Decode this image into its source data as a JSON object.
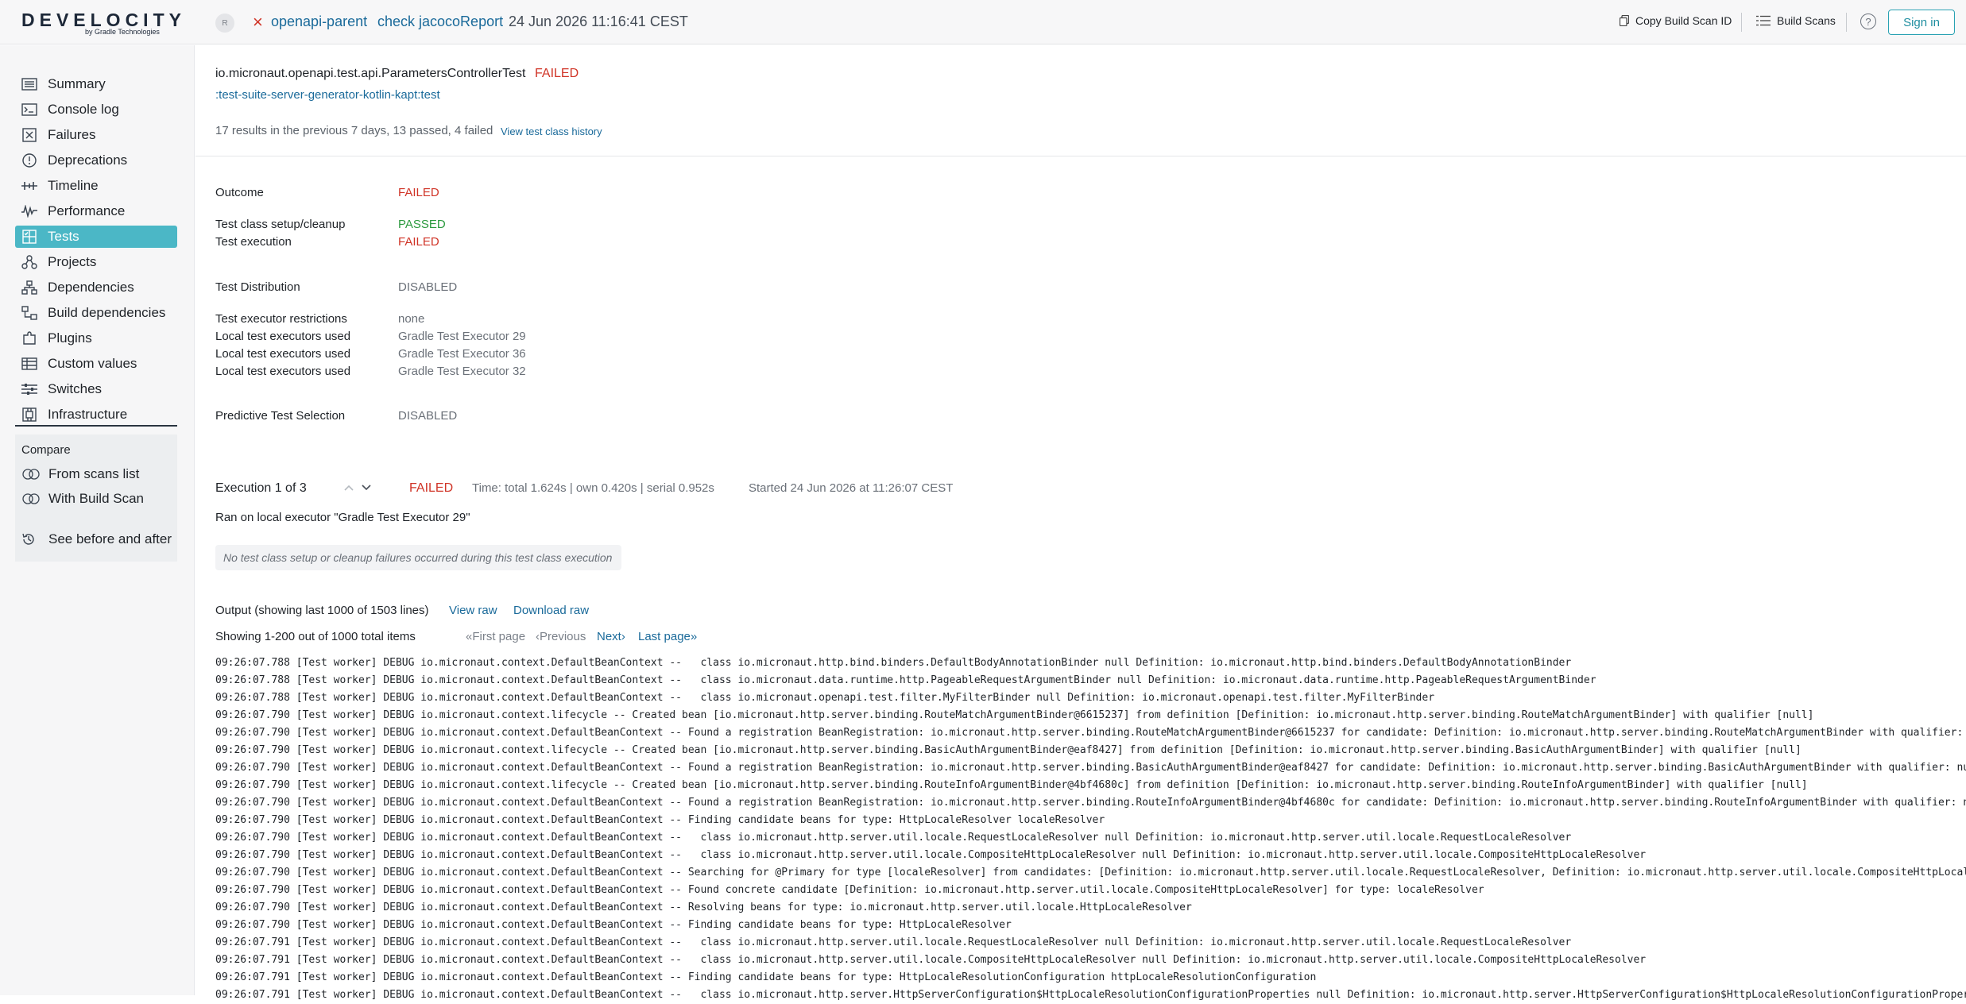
{
  "header": {
    "logo": "DEVELOCITY",
    "logo_sub": "by Gradle Technologies",
    "avatar": "R",
    "project": "openapi-parent",
    "task": "check jacocoReport",
    "datetime": "24 Jun 2026 11:16:41 CEST",
    "copy_id": "Copy Build Scan ID",
    "build_scans": "Build Scans",
    "help": "?",
    "sign_in": "Sign in"
  },
  "sidebar": {
    "items": [
      {
        "label": "Summary",
        "icon": "summary-icon"
      },
      {
        "label": "Console log",
        "icon": "console-icon"
      },
      {
        "label": "Failures",
        "icon": "failures-icon"
      },
      {
        "label": "Deprecations",
        "icon": "deprecations-icon"
      },
      {
        "label": "Timeline",
        "icon": "timeline-icon"
      },
      {
        "label": "Performance",
        "icon": "performance-icon"
      },
      {
        "label": "Tests",
        "icon": "tests-icon"
      },
      {
        "label": "Projects",
        "icon": "projects-icon"
      },
      {
        "label": "Dependencies",
        "icon": "dependencies-icon"
      },
      {
        "label": "Build dependencies",
        "icon": "build-dependencies-icon"
      },
      {
        "label": "Plugins",
        "icon": "plugins-icon"
      },
      {
        "label": "Custom values",
        "icon": "custom-values-icon"
      },
      {
        "label": "Switches",
        "icon": "switches-icon"
      },
      {
        "label": "Infrastructure",
        "icon": "infrastructure-icon"
      }
    ],
    "active": "Tests",
    "compare": {
      "title": "Compare",
      "from_list": "From scans list",
      "with_scan": "With Build Scan"
    },
    "before_after": "See before and after"
  },
  "test": {
    "class_name": "io.micronaut.openapi.test.api.ParametersControllerTest",
    "class_status": "FAILED",
    "task_path": ":test-suite-server-generator-kotlin-kapt:test",
    "history": "17 results in the previous 7 days, 13 passed, 4 failed",
    "history_link": "View test class history"
  },
  "details": {
    "outcome_label": "Outcome",
    "outcome": "FAILED",
    "setup_label": "Test class setup/cleanup",
    "setup": "PASSED",
    "execution_label": "Test execution",
    "execution": "FAILED",
    "distribution_label": "Test Distribution",
    "distribution": "DISABLED",
    "restrictions_label": "Test executor restrictions",
    "restrictions": "none",
    "executors_label": "Local test executors used",
    "executors": [
      "Gradle Test Executor 29",
      "Gradle Test Executor 36",
      "Gradle Test Executor 32"
    ],
    "pts_label": "Predictive Test Selection",
    "pts": "DISABLED"
  },
  "execution": {
    "title": "Execution 1 of 3",
    "status": "FAILED",
    "time": "Time: total 1.624s | own 0.420s | serial 0.952s",
    "started": "Started 24 Jun 2026 at 11:26:07 CEST",
    "ran_on": "Ran on local executor \"Gradle Test Executor 29\"",
    "note": "No test class setup or cleanup failures occurred during this test class execution"
  },
  "output": {
    "title": "Output (showing last 1000 of 1503 lines)",
    "view_raw": "View raw",
    "download_raw": "Download raw",
    "showing": "Showing 1-200 out of 1000 total items",
    "first_page": "«First page",
    "previous": "‹Previous",
    "next": "Next›",
    "last_page": "Last page»",
    "lines": [
      "09:26:07.788 [Test worker] DEBUG io.micronaut.context.DefaultBeanContext --   class io.micronaut.http.bind.binders.DefaultBodyAnnotationBinder null Definition: io.micronaut.http.bind.binders.DefaultBodyAnnotationBinder",
      "09:26:07.788 [Test worker] DEBUG io.micronaut.context.DefaultBeanContext --   class io.micronaut.data.runtime.http.PageableRequestArgumentBinder null Definition: io.micronaut.data.runtime.http.PageableRequestArgumentBinder",
      "09:26:07.788 [Test worker] DEBUG io.micronaut.context.DefaultBeanContext --   class io.micronaut.openapi.test.filter.MyFilterBinder null Definition: io.micronaut.openapi.test.filter.MyFilterBinder",
      "09:26:07.790 [Test worker] DEBUG io.micronaut.context.lifecycle -- Created bean [io.micronaut.http.server.binding.RouteMatchArgumentBinder@6615237] from definition [Definition: io.micronaut.http.server.binding.RouteMatchArgumentBinder] with qualifier [null]",
      "09:26:07.790 [Test worker] DEBUG io.micronaut.context.DefaultBeanContext -- Found a registration BeanRegistration: io.micronaut.http.server.binding.RouteMatchArgumentBinder@6615237 for candidate: Definition: io.micronaut.http.server.binding.RouteMatchArgumentBinder with qualifier: null",
      "09:26:07.790 [Test worker] DEBUG io.micronaut.context.lifecycle -- Created bean [io.micronaut.http.server.binding.BasicAuthArgumentBinder@eaf8427] from definition [Definition: io.micronaut.http.server.binding.BasicAuthArgumentBinder] with qualifier [null]",
      "09:26:07.790 [Test worker] DEBUG io.micronaut.context.DefaultBeanContext -- Found a registration BeanRegistration: io.micronaut.http.server.binding.BasicAuthArgumentBinder@eaf8427 for candidate: Definition: io.micronaut.http.server.binding.BasicAuthArgumentBinder with qualifier: null",
      "09:26:07.790 [Test worker] DEBUG io.micronaut.context.lifecycle -- Created bean [io.micronaut.http.server.binding.RouteInfoArgumentBinder@4bf4680c] from definition [Definition: io.micronaut.http.server.binding.RouteInfoArgumentBinder] with qualifier [null]",
      "09:26:07.790 [Test worker] DEBUG io.micronaut.context.DefaultBeanContext -- Found a registration BeanRegistration: io.micronaut.http.server.binding.RouteInfoArgumentBinder@4bf4680c for candidate: Definition: io.micronaut.http.server.binding.RouteInfoArgumentBinder with qualifier: null",
      "09:26:07.790 [Test worker] DEBUG io.micronaut.context.DefaultBeanContext -- Finding candidate beans for type: HttpLocaleResolver localeResolver",
      "09:26:07.790 [Test worker] DEBUG io.micronaut.context.DefaultBeanContext --   class io.micronaut.http.server.util.locale.RequestLocaleResolver null Definition: io.micronaut.http.server.util.locale.RequestLocaleResolver",
      "09:26:07.790 [Test worker] DEBUG io.micronaut.context.DefaultBeanContext --   class io.micronaut.http.server.util.locale.CompositeHttpLocaleResolver null Definition: io.micronaut.http.server.util.locale.CompositeHttpLocaleResolver",
      "09:26:07.790 [Test worker] DEBUG io.micronaut.context.DefaultBeanContext -- Searching for @Primary for type [localeResolver] from candidates: [Definition: io.micronaut.http.server.util.locale.RequestLocaleResolver, Definition: io.micronaut.http.server.util.locale.CompositeHttpLocaleRes",
      "09:26:07.790 [Test worker] DEBUG io.micronaut.context.DefaultBeanContext -- Found concrete candidate [Definition: io.micronaut.http.server.util.locale.CompositeHttpLocaleResolver] for type: localeResolver",
      "09:26:07.790 [Test worker] DEBUG io.micronaut.context.DefaultBeanContext -- Resolving beans for type: io.micronaut.http.server.util.locale.HttpLocaleResolver",
      "09:26:07.790 [Test worker] DEBUG io.micronaut.context.DefaultBeanContext -- Finding candidate beans for type: HttpLocaleResolver",
      "09:26:07.791 [Test worker] DEBUG io.micronaut.context.DefaultBeanContext --   class io.micronaut.http.server.util.locale.RequestLocaleResolver null Definition: io.micronaut.http.server.util.locale.RequestLocaleResolver",
      "09:26:07.791 [Test worker] DEBUG io.micronaut.context.DefaultBeanContext --   class io.micronaut.http.server.util.locale.CompositeHttpLocaleResolver null Definition: io.micronaut.http.server.util.locale.CompositeHttpLocaleResolver",
      "09:26:07.791 [Test worker] DEBUG io.micronaut.context.DefaultBeanContext -- Finding candidate beans for type: HttpLocaleResolutionConfiguration httpLocaleResolutionConfiguration",
      "09:26:07.791 [Test worker] DEBUG io.micronaut.context.DefaultBeanContext --   class io.micronaut.http.server.HttpServerConfiguration$HttpLocaleResolutionConfigurationProperties null Definition: io.micronaut.http.server.HttpServerConfiguration$HttpLocaleResolutionConfigurationPropertie"
    ]
  }
}
